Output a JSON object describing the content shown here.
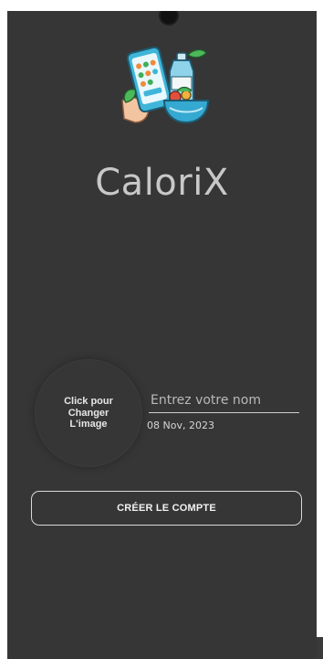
{
  "app": {
    "title": "CaloriX",
    "logo_icon": "phone-bottle-salad-logo-icon"
  },
  "profile": {
    "avatar_label": "Click pour\nChanger\nL'image",
    "name_placeholder": "Entrez votre nom",
    "name_value": "",
    "date": "08 Nov, 2023"
  },
  "actions": {
    "create_account_label": "CRÉER LE COMPTE"
  },
  "colors": {
    "background": "#363636",
    "title": "#c8c8c8",
    "text": "#e9e9e9"
  }
}
